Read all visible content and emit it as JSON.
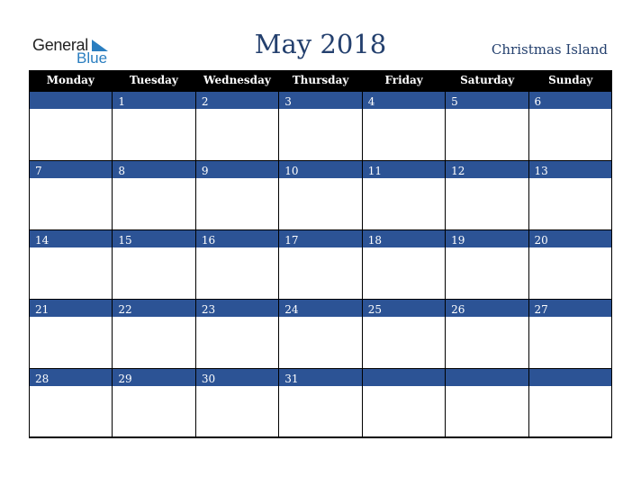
{
  "brand": {
    "word1": "General",
    "word2": "Blue"
  },
  "title": "May 2018",
  "region": "Christmas Island",
  "weekdays": [
    "Monday",
    "Tuesday",
    "Wednesday",
    "Thursday",
    "Friday",
    "Saturday",
    "Sunday"
  ],
  "weeks": [
    [
      "",
      "1",
      "2",
      "3",
      "4",
      "5",
      "6"
    ],
    [
      "7",
      "8",
      "9",
      "10",
      "11",
      "12",
      "13"
    ],
    [
      "14",
      "15",
      "16",
      "17",
      "18",
      "19",
      "20"
    ],
    [
      "21",
      "22",
      "23",
      "24",
      "25",
      "26",
      "27"
    ],
    [
      "28",
      "29",
      "30",
      "31",
      "",
      "",
      ""
    ]
  ],
  "colors": {
    "header_bg": "#000000",
    "band": "#2c5395",
    "title": "#24406e",
    "brand_blue": "#2a7ec0"
  }
}
